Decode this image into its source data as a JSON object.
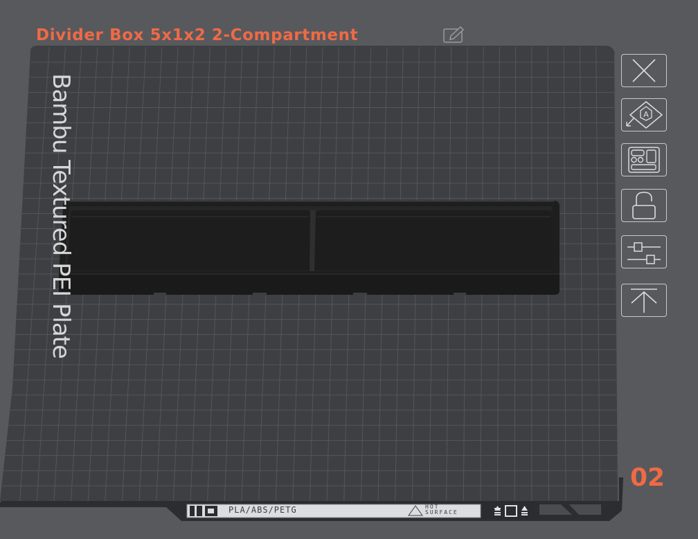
{
  "plate": {
    "title": "Divider Box 5x1x2 2-Compartment",
    "type_label": "Bambu Textured PEI Plate",
    "number": "02",
    "footer": {
      "materials": "PLA/ABS/PETG",
      "warning_line1": "HOT",
      "warning_line2": "SURFACE"
    }
  },
  "toolbar": {
    "items": [
      {
        "name": "delete-plate",
        "icon": "close-icon"
      },
      {
        "name": "auto-orient",
        "icon": "orient-icon"
      },
      {
        "name": "arrange",
        "icon": "arrange-icon"
      },
      {
        "name": "lock-plate",
        "icon": "lock-icon"
      },
      {
        "name": "plate-settings",
        "icon": "sliders-icon"
      },
      {
        "name": "move-to-top",
        "icon": "move-top-icon"
      }
    ]
  },
  "colors": {
    "accent": "#ef6a45",
    "background": "#58595d",
    "plate": "#3e3f43",
    "grid": "#56575b",
    "model": "#1f1f20"
  }
}
